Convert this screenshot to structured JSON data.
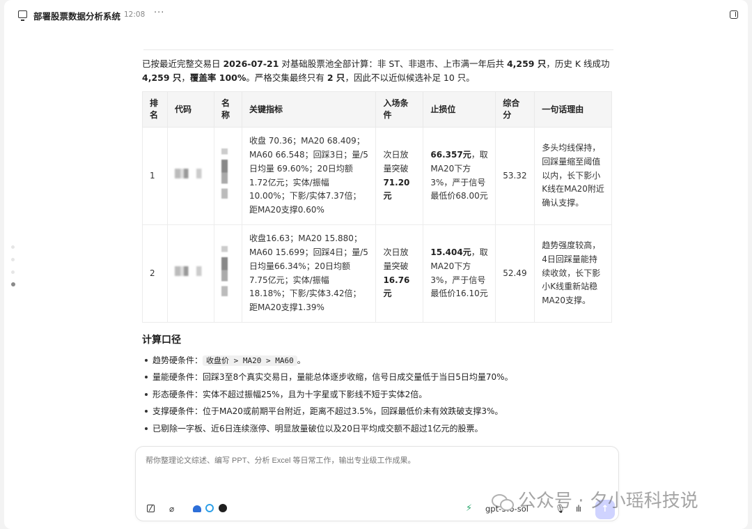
{
  "header": {
    "title": "部署股票数据分析系统",
    "time": "12:08",
    "more_icon": "more-horizontal-icon",
    "panel_icon": "sidebar-toggle-icon"
  },
  "intro": {
    "p1": "已按最近完整交易日 ",
    "date": "2026-07-21",
    "p2": " 对基础股票池全部计算：非 ST、非退市、上市满一年后共 ",
    "count1": "4,259 只",
    "p3": "，历史 K 线成功 ",
    "count2": "4,259 只",
    "p4": "，",
    "coverage": "覆盖率 100%",
    "p5": "。严格交集最终只有 ",
    "final": "2 只",
    "p6": "，因此不以近似候选补足 10 只。"
  },
  "table": {
    "headers": [
      "排名",
      "代码",
      "名称",
      "关键指标",
      "入场条件",
      "止损位",
      "综合分",
      "一句话理由"
    ],
    "rows": [
      {
        "rank": "1",
        "metrics": "收盘 70.36；MA20 68.409；MA60 66.548；回踩3日；量/5日均量 69.60%；20日均额1.72亿元；实体/振幅10.00%；下影/实体7.37倍；距MA20支撑0.60%",
        "entry_prefix": "次日放量突破",
        "entry_price": "71.20元",
        "stop_price": "66.357元",
        "stop_rest": "，取MA20下方3%，严于信号最低价68.00元",
        "score": "53.32",
        "reason": "多头均线保持，回踩量缩至阈值以内，长下影小K线在MA20附近确认支撑。"
      },
      {
        "rank": "2",
        "metrics": "收盘16.63；MA20 15.880；MA60 15.699；回踩4日；量/5日均量66.34%；20日均额7.75亿元；实体/振幅18.18%；下影/实体3.42倍；距MA20支撑1.39%",
        "entry_prefix": "次日放量突破",
        "entry_price": "16.76元",
        "stop_price": "15.404元",
        "stop_rest": "，取MA20下方3%，严于信号最低价16.10元",
        "score": "52.49",
        "reason": "趋势强度较高，4日回踩量能持续收敛，长下影小K线重新站稳MA20支撑。"
      }
    ]
  },
  "calc": {
    "title": "计算口径",
    "rule1_label": "趋势硬条件：",
    "rule1_code": "收盘价 > MA20 > MA60",
    "rule1_end": "。",
    "rule2": "量能硬条件：回踩3至8个真实交易日，量能总体逐步收缩，信号日成交量低于当日5日均量70%。",
    "rule3": "形态硬条件：实体不超过振幅25%，且为十字星或下影线不短于实体2倍。",
    "rule4": "支撑硬条件：位于MA20或前期平台附近，距离不超过3.5%，回踩最低价未有效跌破支撑3%。",
    "rule5": "已剔除一字板、近6日连续涨停、明显放量破位以及20日平均成交额不超过1亿元的股票。"
  },
  "composer": {
    "placeholder": "帮你整理论文综述、编写 PPT、分析 Excel 等日常工作，输出专业级工作成果。",
    "model": "gpt-5.6-sol",
    "tools": [
      "pen-square-icon",
      "paperclip-icon",
      "app-connector-icon",
      "sync-icon",
      "github-icon",
      "bolt-icon",
      "mic-icon",
      "waveform-icon",
      "send-arrow-icon"
    ]
  },
  "watermark": {
    "text": "公众号 · 夕小瑶科技说"
  }
}
